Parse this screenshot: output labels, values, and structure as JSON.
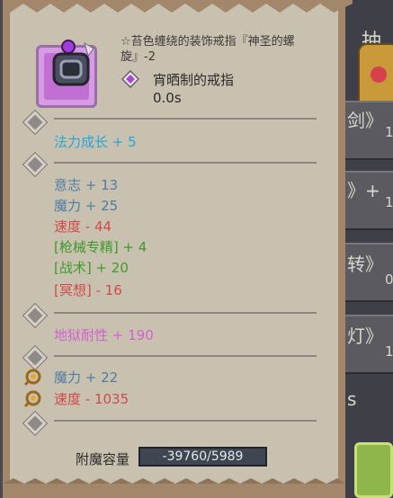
{
  "item": {
    "name": "☆苔色缠绕的装饰戒指『神圣的螺旋』-2",
    "type": "宵晒制的戒指",
    "time": "0.0s"
  },
  "stats": {
    "growth": "法力成长 + 5",
    "willpower": "意志 + 13",
    "magic": "魔力 + 25",
    "speed": "速度 - 44",
    "firearm": "[枪械专精] + 4",
    "tactics": "[战术] + 20",
    "meditation": "[冥想] - 16",
    "hell_resist": "地狱耐性 + 190",
    "rune_magic": "魔力 + 22",
    "rune_speed": "速度 - 1035"
  },
  "enchant": {
    "label": "附魔容量",
    "value": "-39760/5989"
  },
  "background": {
    "top": "抽",
    "r1": "剑》",
    "r1b": "1",
    "r2": "》+",
    "r2b": "1",
    "r3": "转》",
    "r3b": "0",
    "r4": "灯》",
    "r4b": "1",
    "r5": "s"
  },
  "colors": {
    "panel": "#c8c1b0",
    "frame": "#a2876b",
    "item_bg": "#c16fd3"
  }
}
